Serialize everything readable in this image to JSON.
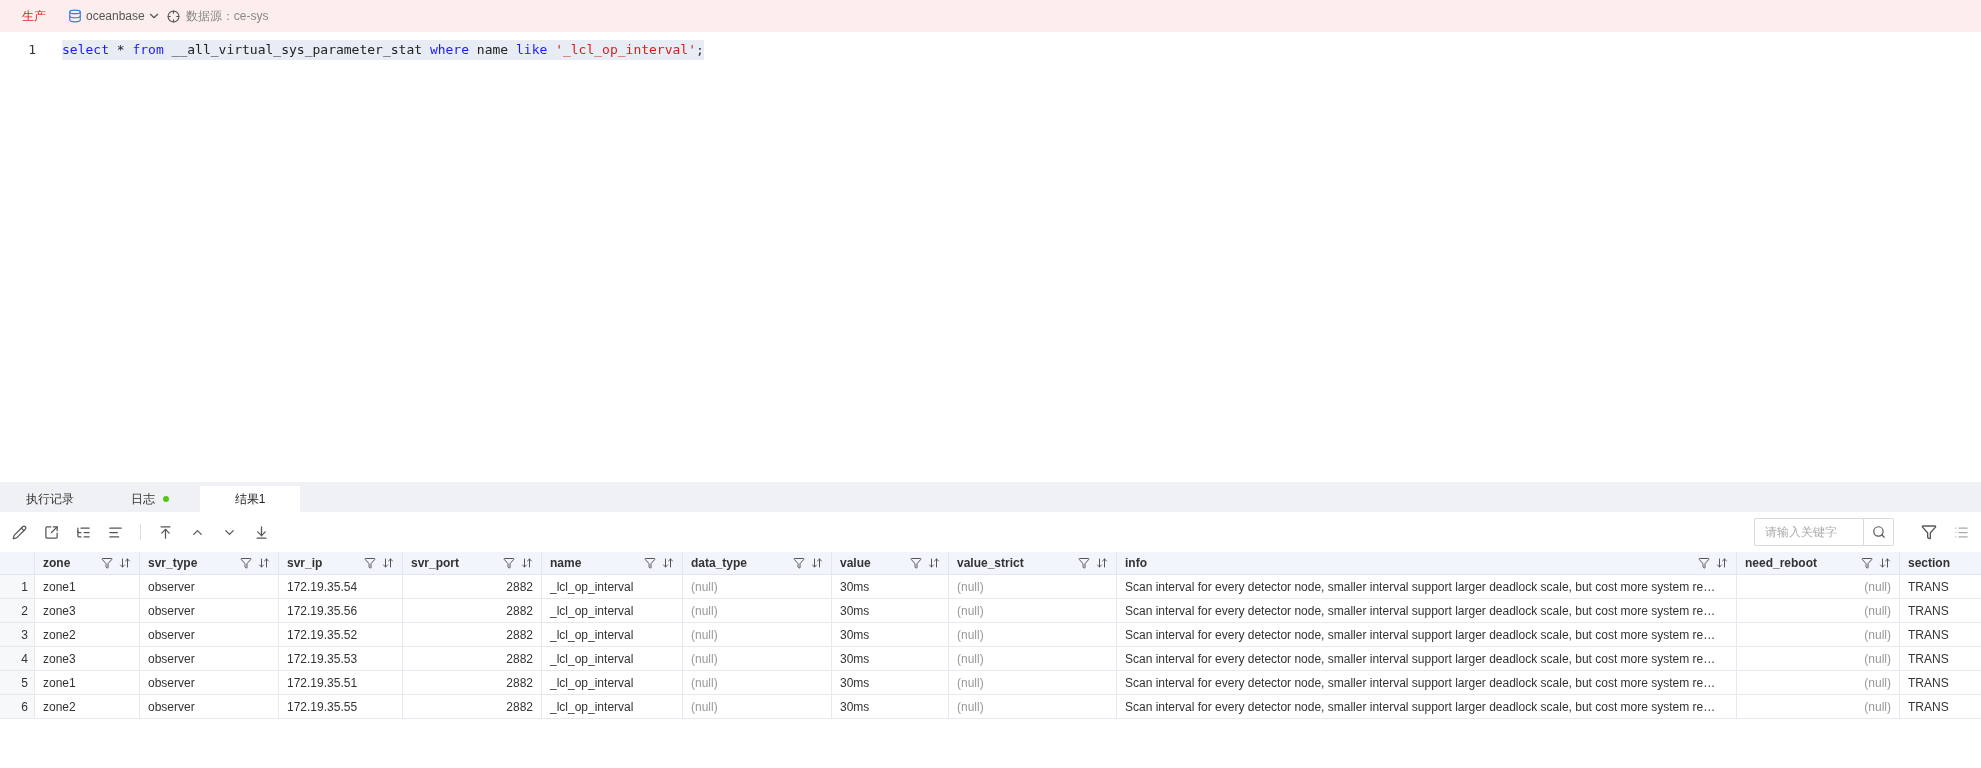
{
  "env_label": "生产",
  "database": "oceanbase",
  "datasource": "数据源：ce-sys",
  "editor": {
    "lines": [
      {
        "number": "1",
        "tokens": [
          {
            "kind": "keyword",
            "text": "select"
          },
          {
            "kind": "plain",
            "text": "*"
          },
          {
            "kind": "keyword",
            "text": "from"
          },
          {
            "kind": "plain",
            "text": "__all_virtual_sys_parameter_stat"
          },
          {
            "kind": "keyword",
            "text": "where"
          },
          {
            "kind": "plain",
            "text": "name"
          },
          {
            "kind": "keyword",
            "text": "like"
          },
          {
            "kind": "string",
            "text": "'_lcl_op_interval'"
          },
          {
            "kind": "punct",
            "text": ";"
          }
        ]
      }
    ]
  },
  "tabs": [
    {
      "label": "执行记录",
      "selected": false,
      "dot": false
    },
    {
      "label": "日志",
      "selected": false,
      "dot": true
    },
    {
      "label": "结果1",
      "selected": true,
      "dot": false
    }
  ],
  "search": {
    "placeholder": "请输入关键字"
  },
  "table": {
    "columns": [
      {
        "name": "zone",
        "align_right": false,
        "muted": false,
        "icons": true
      },
      {
        "name": "svr_type",
        "align_right": false,
        "muted": false,
        "icons": true
      },
      {
        "name": "svr_ip",
        "align_right": false,
        "muted": false,
        "icons": true
      },
      {
        "name": "svr_port",
        "align_right": true,
        "muted": false,
        "icons": true
      },
      {
        "name": "name",
        "align_right": false,
        "muted": false,
        "icons": true
      },
      {
        "name": "data_type",
        "align_right": false,
        "muted": true,
        "icons": true
      },
      {
        "name": "value",
        "align_right": false,
        "muted": false,
        "icons": true
      },
      {
        "name": "value_strict",
        "align_right": false,
        "muted": true,
        "icons": true
      },
      {
        "name": "info",
        "align_right": false,
        "muted": false,
        "icons": true
      },
      {
        "name": "need_reboot",
        "align_right": true,
        "muted": true,
        "icons": true
      },
      {
        "name": "section",
        "align_right": false,
        "muted": false,
        "icons": false
      }
    ],
    "rows": [
      {
        "number": "1",
        "cells": [
          "zone1",
          "observer",
          "172.19.35.54",
          "2882",
          "_lcl_op_interval",
          "(null)",
          "30ms",
          "(null)",
          "Scan interval for every detector node, smaller interval support larger deadlock scale, but cost more system re…",
          "(null)",
          "TRANS"
        ]
      },
      {
        "number": "2",
        "cells": [
          "zone3",
          "observer",
          "172.19.35.56",
          "2882",
          "_lcl_op_interval",
          "(null)",
          "30ms",
          "(null)",
          "Scan interval for every detector node, smaller interval support larger deadlock scale, but cost more system re…",
          "(null)",
          "TRANS"
        ]
      },
      {
        "number": "3",
        "cells": [
          "zone2",
          "observer",
          "172.19.35.52",
          "2882",
          "_lcl_op_interval",
          "(null)",
          "30ms",
          "(null)",
          "Scan interval for every detector node, smaller interval support larger deadlock scale, but cost more system re…",
          "(null)",
          "TRANS"
        ]
      },
      {
        "number": "4",
        "cells": [
          "zone3",
          "observer",
          "172.19.35.53",
          "2882",
          "_lcl_op_interval",
          "(null)",
          "30ms",
          "(null)",
          "Scan interval for every detector node, smaller interval support larger deadlock scale, but cost more system re…",
          "(null)",
          "TRANS"
        ]
      },
      {
        "number": "5",
        "cells": [
          "zone1",
          "observer",
          "172.19.35.51",
          "2882",
          "_lcl_op_interval",
          "(null)",
          "30ms",
          "(null)",
          "Scan interval for every detector node, smaller interval support larger deadlock scale, but cost more system re…",
          "(null)",
          "TRANS"
        ]
      },
      {
        "number": "6",
        "cells": [
          "zone2",
          "observer",
          "172.19.35.55",
          "2882",
          "_lcl_op_interval",
          "(null)",
          "30ms",
          "(null)",
          "Scan interval for every detector node, smaller interval support larger deadlock scale, but cost more system re…",
          "(null)",
          "TRANS"
        ]
      }
    ]
  }
}
